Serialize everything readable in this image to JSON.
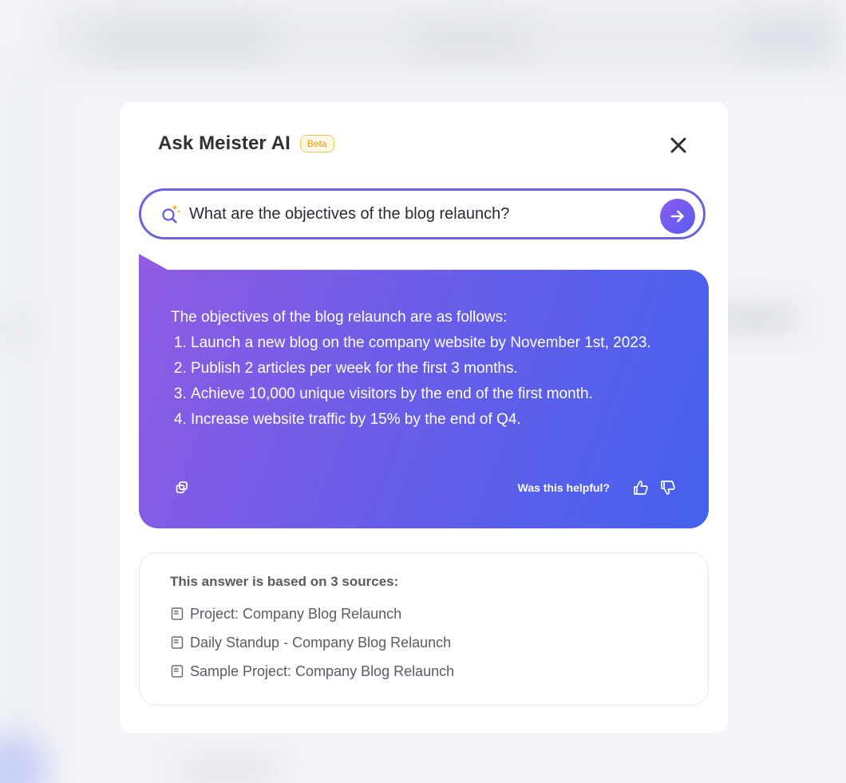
{
  "modal": {
    "title": "Ask Meister AI",
    "badge": "Beta"
  },
  "search": {
    "value": "What are the objectives of the blog relaunch?",
    "icon": "sparkle-search-icon"
  },
  "answer": {
    "intro": "The objectives of the blog relaunch are as follows:",
    "items": [
      "Launch a new blog on the company website by November 1st, 2023.",
      "Publish 2 articles per week for the first 3 months.",
      "Achieve 10,000 unique visitors by the end of the first month.",
      "Increase website traffic by 15% by the end of Q4."
    ],
    "helpful_label": "Was this helpful?"
  },
  "sources": {
    "heading": "This answer is based on 3 sources:",
    "items": [
      "Project: Company Blog Relaunch",
      "Daily Standup - Company Blog Relaunch",
      "Sample Project: Company Blog Relaunch"
    ]
  },
  "colors": {
    "accent": "#6b63e0",
    "answer_gradient_start": "#8f5ce3",
    "answer_gradient_end": "#4361ee",
    "beta": "#e49a1a"
  }
}
